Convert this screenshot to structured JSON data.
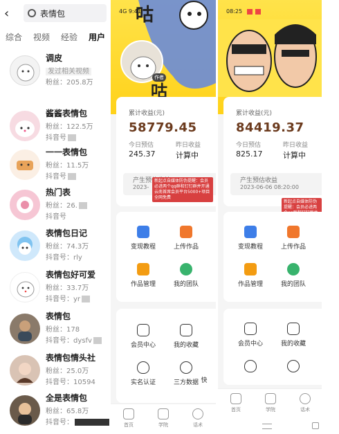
{
  "search": {
    "query": "表情包",
    "tabs": [
      "综合",
      "视频",
      "经验",
      "用户"
    ],
    "results": [
      {
        "name": "调皮",
        "line2": "发过相关视频",
        "line3": "粉丝：205.8万"
      },
      {
        "name": "酱酱表情包",
        "line2": "粉丝：122.5万",
        "line3": "抖音号"
      },
      {
        "name": "一一表情包",
        "line2": "粉丝：11.5万",
        "line3": "抖音号"
      },
      {
        "name": "热门表",
        "line2": "粉丝：26.",
        "line3": "抖音号"
      },
      {
        "name": "表情包日记",
        "line2": "粉丝：74.3万",
        "line3": "抖音号：rly"
      },
      {
        "name": "表情包好可爱",
        "line2": "粉丝：33.7万",
        "line3": "抖音号：yr"
      },
      {
        "name": "表情包",
        "line2": "粉丝：178",
        "line3": "抖音号：dysfv"
      },
      {
        "name": "表情包情头社",
        "line2": "粉丝：25.0万",
        "line3": "抖音号：10594"
      },
      {
        "name": "全是表情包",
        "line2": "粉丝：65.8万",
        "line3": "抖音号："
      }
    ]
  },
  "app_left": {
    "status": "4G 9:41",
    "profile_tag": "作者",
    "card": {
      "label": "累计收益(元)",
      "amount": "58779.45",
      "today_label": "今日预估",
      "today_value": "245.37",
      "yesterday_label": "昨日收益",
      "yesterday_value": "计算中",
      "pending_label": "产生预估收益",
      "pending_time": "2023-"
    },
    "notice": "新起点自媒体防伪提醒：会员必进两个qq群和钉钉群并开通云南首席会员平台5000+项目全网免费",
    "menu1": [
      {
        "label": "变现教程",
        "color": "#3d7ee8"
      },
      {
        "label": "上传作品",
        "color": "#f0772c"
      },
      {
        "label": "作品管理",
        "color": "#f39c12"
      },
      {
        "label": "我的团队",
        "color": "#38b36d"
      }
    ],
    "menu2": [
      {
        "label": "会员中心"
      },
      {
        "label": "我的收藏"
      },
      {
        "label": "实名认证"
      },
      {
        "label": "三方数据"
      },
      {
        "label": "快"
      }
    ],
    "nav": [
      "首页",
      "学院",
      "话术"
    ]
  },
  "app_right": {
    "status": "08:25",
    "card": {
      "label": "累计收益(元)",
      "amount": "84419.37",
      "today_label": "今日预估",
      "today_value": "825.17",
      "yesterday_label": "昨日收益",
      "yesterday_value": "计算中",
      "pending_label": "产生预估收益",
      "pending_time": "2023-06-06 08:20:00"
    },
    "notice": "新起点自媒体防伪提醒：会员必进两个qq群和钉钉群并开通云南首席会员平台5000+项目全网免费",
    "menu1": [
      {
        "label": "变现教程",
        "color": "#3d7ee8"
      },
      {
        "label": "上传作品",
        "color": "#f0772c"
      },
      {
        "label": "作品管理",
        "color": "#f39c12"
      },
      {
        "label": "我的团队",
        "color": "#38b36d"
      }
    ],
    "menu2": [
      {
        "label": "会员中心"
      },
      {
        "label": "我的收藏"
      }
    ],
    "nav": [
      "首页",
      "学院",
      "话术"
    ]
  }
}
